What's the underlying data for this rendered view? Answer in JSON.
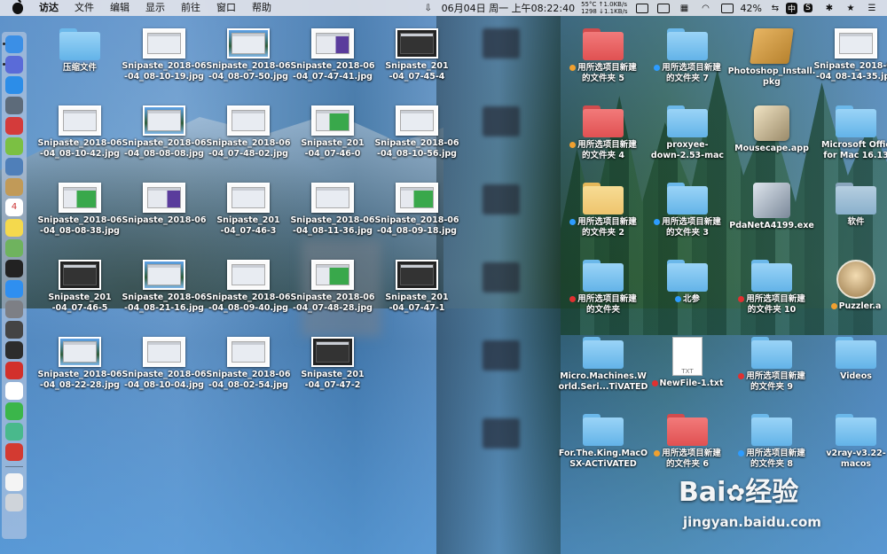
{
  "menubar": {
    "app_name": "访达",
    "menus": [
      "文件",
      "编辑",
      "显示",
      "前往",
      "窗口",
      "帮助"
    ],
    "cpu_temp": "55°C",
    "fan": "1298",
    "net_up": "↑1.0KB/s",
    "net_down": "↓1.1KB/s",
    "battery": "42%",
    "datetime": "06月04日 周一 上午08:22:40",
    "input_method": "中",
    "status_icons": [
      "download-icon",
      "display-icon",
      "box-icon",
      "grid-icon",
      "wifi-icon",
      "battery-icon",
      "s-icon",
      "bluetooth-icon",
      "star-icon",
      "list-icon"
    ]
  },
  "dock": {
    "apps": [
      "finder",
      "siri",
      "safari",
      "launchpad",
      "eraser",
      "android",
      "preview",
      "notes-book",
      "calendar",
      "stickies",
      "maps",
      "terminal",
      "app-store",
      "system-preferences",
      "activity",
      "terminal-2",
      "vivaldi",
      "yandex",
      "wechat",
      "shadowsocks",
      "netease-music",
      "document",
      "trash"
    ],
    "calendar_day": "4"
  },
  "items_left": [
    {
      "label": "压缩文件",
      "kind": "folder",
      "color": "blue"
    },
    {
      "label": "Snipaste_2018-06\n-04_08-10-19.jpg",
      "kind": "thumb",
      "variant": ""
    },
    {
      "label": "Snipaste_2018-06\n-04_08-07-50.jpg",
      "kind": "thumb",
      "variant": "photo"
    },
    {
      "label": "Snipaste_2018-06\n-04_07-47-41.jpg",
      "kind": "thumb",
      "variant": "purple"
    },
    {
      "label": "Snipaste_201\n-04_07-45-4",
      "kind": "thumb",
      "variant": "dark"
    },
    {
      "label": "Snipaste_2018-06\n-04_08-10-42.jpg",
      "kind": "thumb",
      "variant": ""
    },
    {
      "label": "Snipaste_2018-06\n-04_08-08-08.jpg",
      "kind": "thumb",
      "variant": "photo"
    },
    {
      "label": "Snipaste_2018-06\n-04_07-48-02.jpg",
      "kind": "thumb",
      "variant": ""
    },
    {
      "label": "Snipaste_201\n-04_07-46-0",
      "kind": "thumb",
      "variant": "green"
    },
    {
      "label": "Snipaste_2018-06\n-04_08-10-56.jpg",
      "kind": "thumb",
      "variant": ""
    },
    {
      "label": "Snipaste_2018-06\n-04_08-08-38.jpg",
      "kind": "thumb",
      "variant": "green"
    },
    {
      "label": "Snipaste_2018-06",
      "kind": "thumb",
      "variant": "purple"
    },
    {
      "label": "Snipaste_201\n-04_07-46-3",
      "kind": "thumb",
      "variant": ""
    },
    {
      "label": "Snipaste_2018-06\n-04_08-11-36.jpg",
      "kind": "thumb",
      "variant": ""
    },
    {
      "label": "Snipaste_2018-06\n-04_08-09-18.jpg",
      "kind": "thumb",
      "variant": "green"
    },
    {
      "label": "Snipaste_201\n-04_07-46-5",
      "kind": "thumb",
      "variant": "dark"
    },
    {
      "label": "Snipaste_2018-06\n-04_08-21-16.jpg",
      "kind": "thumb",
      "variant": "photo"
    },
    {
      "label": "Snipaste_2018-06\n-04_08-09-40.jpg",
      "kind": "thumb",
      "variant": ""
    },
    {
      "label": "Snipaste_2018-06\n-04_07-48-28.jpg",
      "kind": "thumb",
      "variant": "green"
    },
    {
      "label": "Snipaste_201\n-04_07-47-1",
      "kind": "thumb",
      "variant": "dark"
    },
    {
      "label": "Snipaste_2018-06\n-04_08-22-28.jpg",
      "kind": "thumb",
      "variant": "photo"
    },
    {
      "label": "Snipaste_2018-06\n-04_08-10-04.jpg",
      "kind": "thumb",
      "variant": ""
    },
    {
      "label": "Snipaste_2018-06\n-04_08-02-54.jpg",
      "kind": "thumb",
      "variant": ""
    },
    {
      "label": "Snipaste_201\n-04_07-47-2",
      "kind": "thumb",
      "variant": "dark"
    }
  ],
  "items_right": [
    {
      "label": "用所选项目新建\n的文件夹 5",
      "kind": "folder",
      "color": "red",
      "tag": "#f0a030"
    },
    {
      "label": "用所选项目新建\n的文件夹 7",
      "kind": "folder",
      "color": "blue",
      "tag": "#2d9cff"
    },
    {
      "label": "Photoshop_Install.\npkg",
      "kind": "pkg",
      "color": "",
      "tag": ""
    },
    {
      "label": "Snipaste_2018-06\n-04_08-14-35.jpg",
      "kind": "thumb",
      "color": "",
      "tag": ""
    },
    {
      "label": "用所选项目新建\n的文件夹 4",
      "kind": "folder",
      "color": "red",
      "tag": "#f0a030"
    },
    {
      "label": "proxyee-\ndown-2.53-mac",
      "kind": "folder",
      "color": "blue",
      "tag": ""
    },
    {
      "label": "Mousecape.app",
      "kind": "app",
      "color": "",
      "tag": ""
    },
    {
      "label": "Microsoft Offic\nfor Mac 16.13",
      "kind": "folder",
      "color": "blue",
      "tag": ""
    },
    {
      "label": "用所选项目新建\n的文件夹 2",
      "kind": "folder",
      "color": "yellow",
      "tag": "#2d9cff"
    },
    {
      "label": "用所选项目新建\n的文件夹 3",
      "kind": "folder",
      "color": "blue",
      "tag": "#2d9cff"
    },
    {
      "label": "PdaNetA4199.exe",
      "kind": "pda",
      "color": "",
      "tag": ""
    },
    {
      "label": "软件",
      "kind": "folder",
      "color": "gray",
      "tag": ""
    },
    {
      "label": "用所选项目新建\n的文件夹",
      "kind": "folder",
      "color": "blue",
      "tag": "#e03030"
    },
    {
      "label": "北参",
      "kind": "folder",
      "color": "blue",
      "tag": "#2d9cff"
    },
    {
      "label": "用所选项目新建\n的文件夹 10",
      "kind": "folder",
      "color": "blue",
      "tag": "#e03030"
    },
    {
      "label": "Puzzler.a",
      "kind": "avatar",
      "color": "",
      "tag": "#f0a030"
    },
    {
      "label": "Micro.Machines.W\norld.Seri...TiVATED",
      "kind": "folder",
      "color": "blue",
      "tag": ""
    },
    {
      "label": "NewFile-1.txt",
      "kind": "doc",
      "color": "",
      "tag": "#e03030"
    },
    {
      "label": "用所选项目新建\n的文件夹 9",
      "kind": "folder",
      "color": "blue",
      "tag": "#e03030"
    },
    {
      "label": "Videos",
      "kind": "folder",
      "color": "blue",
      "tag": ""
    },
    {
      "label": "For.The.King.MacO\nSX-ACTiVATED",
      "kind": "folder",
      "color": "blue",
      "tag": ""
    },
    {
      "label": "用所选项目新建\n的文件夹 6",
      "kind": "folder",
      "color": "red",
      "tag": "#f0a030"
    },
    {
      "label": "用所选项目新建\n的文件夹 8",
      "kind": "folder",
      "color": "blue",
      "tag": "#2d9cff"
    },
    {
      "label": "v2ray-v3.22-\nmacos",
      "kind": "folder",
      "color": "blue",
      "tag": ""
    }
  ],
  "watermark": {
    "brand_left": "Bai",
    "brand_right": "经验",
    "url": "jingyan.baidu.com"
  }
}
